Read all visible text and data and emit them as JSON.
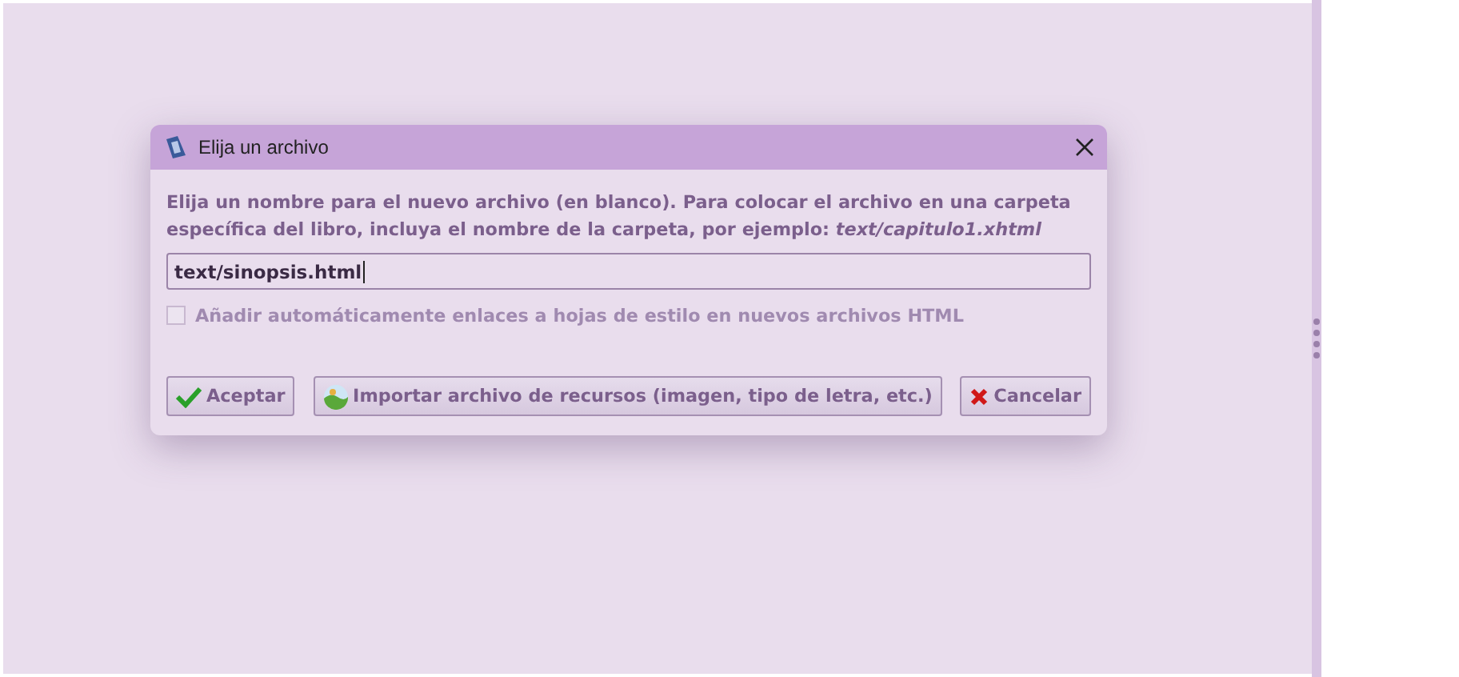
{
  "window": {
    "title": "Elija un archivo"
  },
  "instructions": "Elija un nombre para el nuevo archivo (en blanco). Para colocar el archivo en una carpeta específica del libro, incluya el nombre de la carpeta, por ejemplo: *text/capitulo1.xhtml*",
  "filename": {
    "value": "text/sinopsis.html"
  },
  "checkbox": {
    "label": "Añadir automáticamente enlaces a hojas de estilo en nuevos archivos HTML",
    "checked": false,
    "disabled": true
  },
  "buttons": [
    {
      "kind": "accept",
      "label": "Aceptar"
    },
    {
      "kind": "import",
      "label": "Importar archivo de recursos (imagen, tipo de letra, etc.)"
    },
    {
      "kind": "cancel",
      "label": "Cancelar"
    }
  ]
}
